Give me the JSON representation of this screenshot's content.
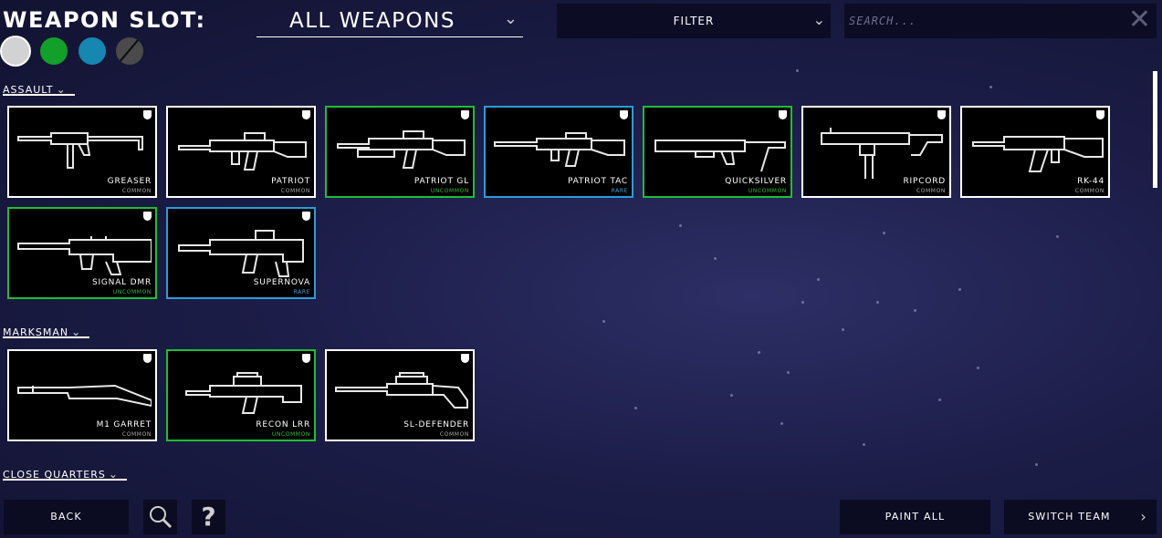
{
  "header": {
    "slot_label": "WEAPON SLOT:",
    "slot_value": "ALL WEAPONS",
    "filter_label": "FILTER",
    "search_placeholder": "SEARCH...",
    "search_value": ""
  },
  "paint_swatches": [
    {
      "name": "white",
      "color": "#d2d2d2",
      "selected": true
    },
    {
      "name": "green",
      "color": "#12a02a",
      "selected": false
    },
    {
      "name": "blue",
      "color": "#1587b0",
      "selected": false
    },
    {
      "name": "none",
      "color": "#4a4a4a",
      "selected": false
    }
  ],
  "rarity_colors": {
    "common": "#ffffff",
    "uncommon": "#1fbe33",
    "rare": "#2a9dd6"
  },
  "sections": [
    {
      "title": "ASSAULT",
      "weapons": [
        {
          "name": "GREASER",
          "rarity": "COMMON"
        },
        {
          "name": "PATRIOT",
          "rarity": "COMMON"
        },
        {
          "name": "PATRIOT GL",
          "rarity": "UNCOMMON"
        },
        {
          "name": "PATRIOT TAC",
          "rarity": "RARE"
        },
        {
          "name": "QUICKSILVER",
          "rarity": "UNCOMMON"
        },
        {
          "name": "RIPCORD",
          "rarity": "COMMON"
        },
        {
          "name": "RK-44",
          "rarity": "COMMON"
        },
        {
          "name": "SIGNAL DMR",
          "rarity": "UNCOMMON"
        },
        {
          "name": "SUPERNOVA",
          "rarity": "RARE"
        }
      ]
    },
    {
      "title": "MARKSMAN",
      "weapons": [
        {
          "name": "M1 GARRET",
          "rarity": "COMMON"
        },
        {
          "name": "RECON LRR",
          "rarity": "UNCOMMON"
        },
        {
          "name": "SL-DEFENDER",
          "rarity": "COMMON"
        }
      ]
    },
    {
      "title": "CLOSE QUARTERS",
      "weapons": []
    }
  ],
  "footer": {
    "back_label": "BACK",
    "help_glyph": "?",
    "paint_all_label": "PAINT ALL",
    "switch_team_label": "SWITCH TEAM"
  }
}
